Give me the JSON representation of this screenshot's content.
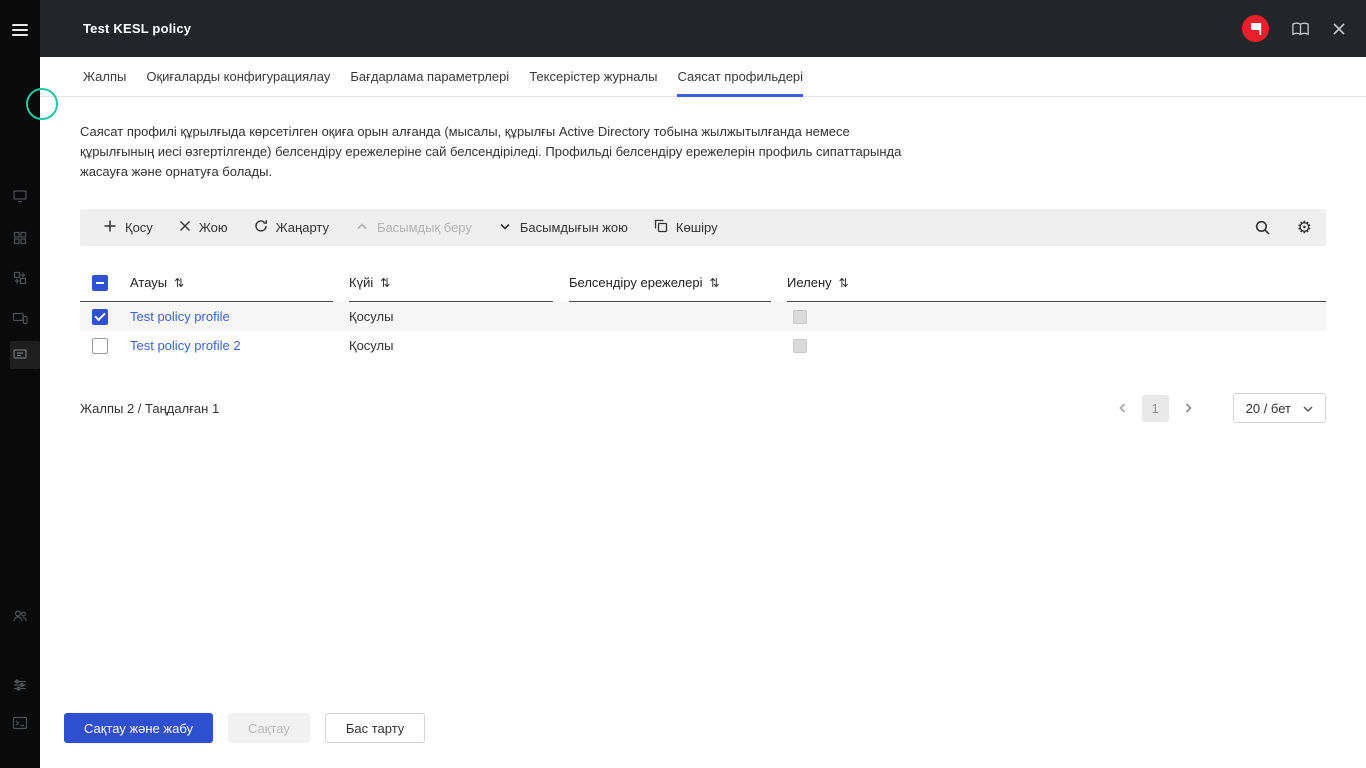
{
  "window": {
    "title": "Test KESL policy"
  },
  "colors": {
    "accent": "#2e51d4",
    "link": "#3a62d8",
    "header_bg": "#22262a",
    "sidebar_bg": "#0a0a0a",
    "toolbar_bg": "#efefef",
    "brand_red": "#e7202c",
    "brand_teal": "#1fc9a7"
  },
  "icons": {
    "sort": "⇅",
    "gear": "⚙"
  },
  "tabs": [
    {
      "label": "Жалпы",
      "active": false
    },
    {
      "label": "Оқиғаларды конфигурациялау",
      "active": false
    },
    {
      "label": "Бағдарлама параметрлері",
      "active": false
    },
    {
      "label": "Тексерістер журналы",
      "active": false
    },
    {
      "label": "Саясат профильдері",
      "active": true
    }
  ],
  "description": "Саясат профилі құрылғыда көрсетілген оқиға орын алғанда (мысалы, құрылғы Active Directory тобына жылжытылғанда немесе құрылғының иесі өзгертілгенде) белсендіру ережелеріне сай белсендіріледі. Профильді белсендіру ережелерін профиль сипаттарында жасауға және орнатуға болады.",
  "toolbar": {
    "add": "Қосу",
    "delete": "Жою",
    "refresh": "Жаңарту",
    "prioritize": "Басымдық беру",
    "deprioritize": "Басымдығын жою",
    "copy": "Көшіру"
  },
  "table": {
    "columns": [
      "Атауы",
      "Күйі",
      "Белсендіру ережелері",
      "Иелену"
    ],
    "rows": [
      {
        "name": "Test policy profile",
        "status": "Қосулы",
        "rules": "",
        "checked": true
      },
      {
        "name": "Test policy profile 2",
        "status": "Қосулы",
        "rules": "",
        "checked": false
      }
    ]
  },
  "footer": {
    "summary": "Жалпы 2 / Таңдалған 1",
    "page": "1",
    "page_size": "20 / бет"
  },
  "actions": {
    "save_close": "Сақтау және жабу",
    "save": "Сақтау",
    "cancel": "Бас тарту"
  }
}
